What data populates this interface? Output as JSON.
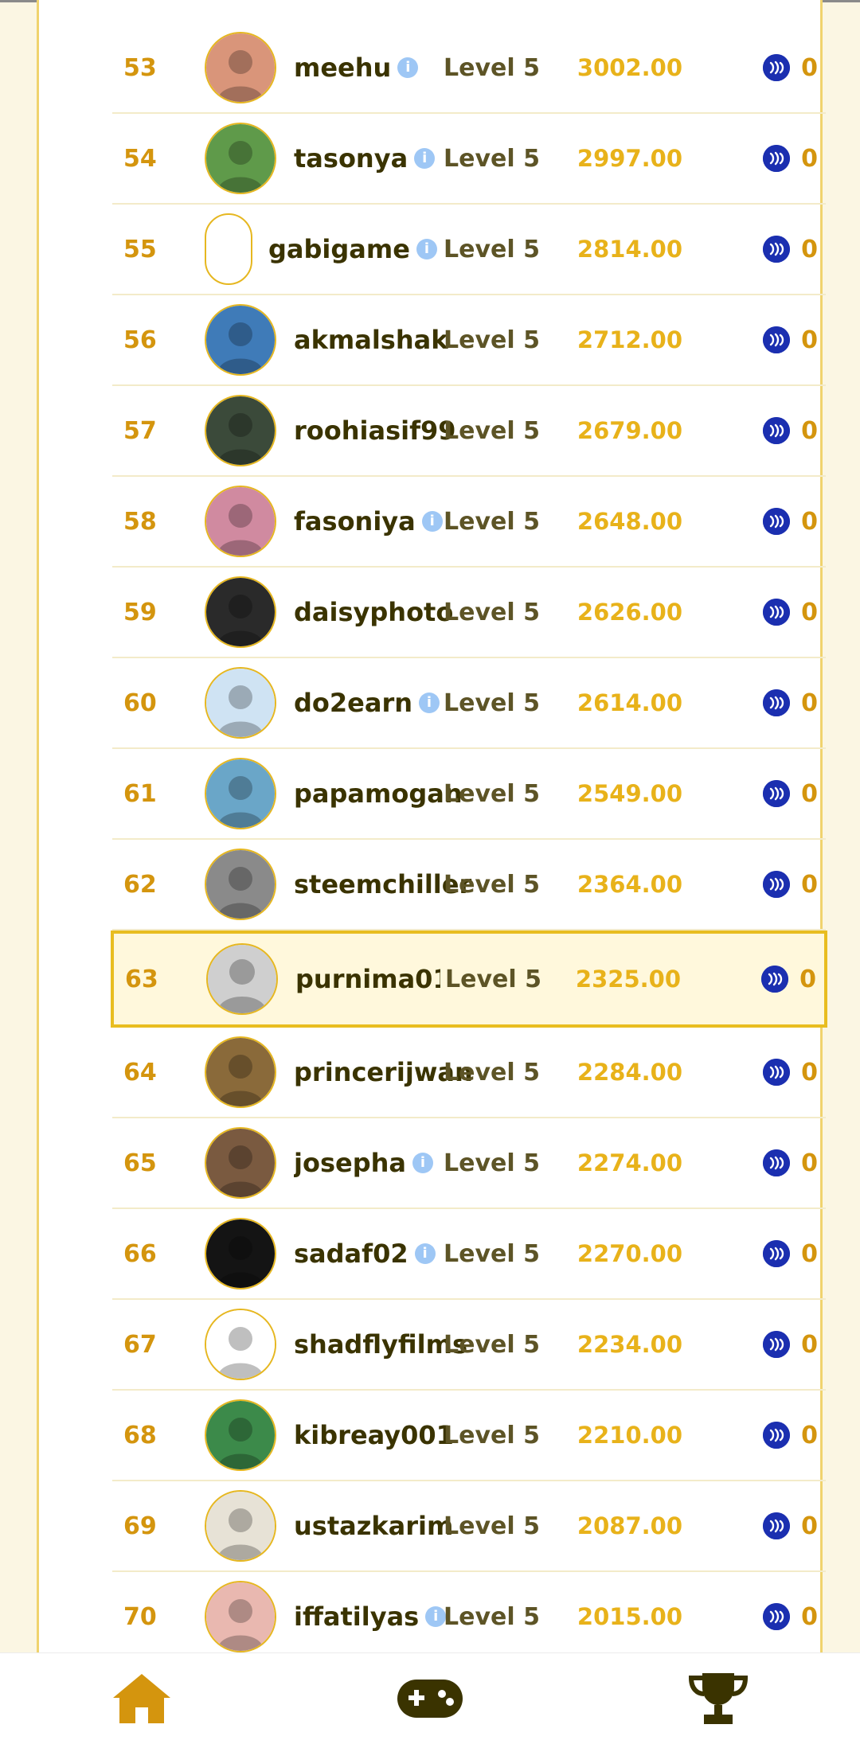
{
  "colors": {
    "accent": "#e8bd20",
    "rank": "#d4950e",
    "points": "#e8b21a",
    "steem": "#1b2fb0",
    "name": "#3a3300"
  },
  "rows": [
    {
      "rank": "53",
      "name": "meehu",
      "info": true,
      "level": "Level 5",
      "points": "3002.00",
      "reward": "0",
      "avatar": "#d9957a"
    },
    {
      "rank": "54",
      "name": "tasonya",
      "info": true,
      "level": "Level 5",
      "points": "2997.00",
      "reward": "0",
      "avatar": "#5f9a4a"
    },
    {
      "rank": "55",
      "name": "gabigame",
      "info": true,
      "level": "Level 5",
      "points": "2814.00",
      "reward": "0",
      "avatar": "empty"
    },
    {
      "rank": "56",
      "name": "akmalshak",
      "info": false,
      "level": "Level 5",
      "points": "2712.00",
      "reward": "0",
      "avatar": "#3f7bb8"
    },
    {
      "rank": "57",
      "name": "roohiasif99",
      "info": false,
      "level": "Level 5",
      "points": "2679.00",
      "reward": "0",
      "avatar": "#3b4a3a"
    },
    {
      "rank": "58",
      "name": "fasoniya",
      "info": true,
      "level": "Level 5",
      "points": "2648.00",
      "reward": "0",
      "avatar": "#d08aa0"
    },
    {
      "rank": "59",
      "name": "daisyphoto",
      "info": false,
      "level": "Level 5",
      "points": "2626.00",
      "reward": "0",
      "avatar": "#2a2a2a"
    },
    {
      "rank": "60",
      "name": "do2earn",
      "info": true,
      "level": "Level 5",
      "points": "2614.00",
      "reward": "0",
      "avatar": "#cfe3f3"
    },
    {
      "rank": "61",
      "name": "papamogan",
      "info": false,
      "level": "Level 5",
      "points": "2549.00",
      "reward": "0",
      "avatar": "#6aa6c8"
    },
    {
      "rank": "62",
      "name": "steemchiller",
      "info": false,
      "level": "Level 5",
      "points": "2364.00",
      "reward": "0",
      "avatar": "#8a8a8a"
    },
    {
      "rank": "63",
      "name": "purnima01",
      "info": false,
      "level": "Level 5",
      "points": "2325.00",
      "reward": "0",
      "avatar": "placeholder",
      "highlight": true
    },
    {
      "rank": "64",
      "name": "princerijwan",
      "info": false,
      "level": "Level 5",
      "points": "2284.00",
      "reward": "0",
      "avatar": "#8a6a3a"
    },
    {
      "rank": "65",
      "name": "josepha",
      "info": true,
      "level": "Level 5",
      "points": "2274.00",
      "reward": "0",
      "avatar": "#7a5a40"
    },
    {
      "rank": "66",
      "name": "sadaf02",
      "info": true,
      "level": "Level 5",
      "points": "2270.00",
      "reward": "0",
      "avatar": "#141414"
    },
    {
      "rank": "67",
      "name": "shadflyfilms",
      "info": false,
      "level": "Level 5",
      "points": "2234.00",
      "reward": "0",
      "avatar": "#ffffff"
    },
    {
      "rank": "68",
      "name": "kibreay001",
      "info": false,
      "level": "Level 5",
      "points": "2210.00",
      "reward": "0",
      "avatar": "#3c8a4a"
    },
    {
      "rank": "69",
      "name": "ustazkarim",
      "info": false,
      "level": "Level 5",
      "points": "2087.00",
      "reward": "0",
      "avatar": "#e7e2d6"
    },
    {
      "rank": "70",
      "name": "iffatilyas",
      "info": true,
      "level": "Level 5",
      "points": "2015.00",
      "reward": "0",
      "avatar": "#e9b8b0"
    }
  ],
  "info_glyph": "i",
  "nav": [
    {
      "name": "home",
      "icon": "home-icon"
    },
    {
      "name": "games",
      "icon": "gamepad-icon"
    },
    {
      "name": "leaderboard",
      "icon": "trophy-icon"
    }
  ]
}
